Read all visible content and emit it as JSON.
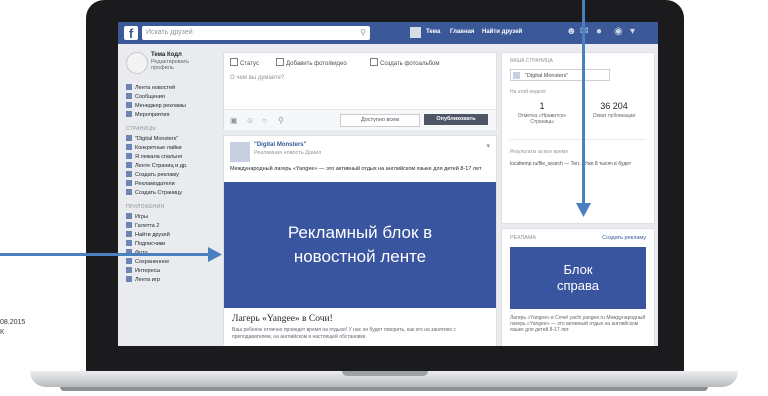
{
  "colors": {
    "fb_blue": "#3b5998",
    "ad_blue": "#3a559f",
    "arrow": "#4a7fc0"
  },
  "topbar": {
    "logo": "f",
    "search_placeholder": "Искать друзей",
    "nav": [
      "Тема",
      "Главная",
      "Найти друзей"
    ]
  },
  "left_nav": {
    "profile_name": "Тема Кодл",
    "profile_edit": "Редактировать профиль",
    "main_items": [
      "Лента новостей",
      "Сообщения",
      "Менеджер рекламы",
      "Мероприятия"
    ],
    "pages_section": "СТРАНИЦЫ",
    "pages_items": [
      "\"Digital Monsters\"",
      "Конкретные лайки",
      "Я лежала спальня",
      "Ленте Страниц и др.",
      "Создать рекламу",
      "Рекламодатели",
      "Создать Страницу"
    ],
    "apps_section": "ПРИЛОЖЕНИЯ",
    "apps_items": [
      "Игры",
      "Галетта 2",
      "Найти друзей",
      "Подписчики",
      "Фото",
      "Сохраненное",
      "Интересы",
      "Лента игр"
    ]
  },
  "composer": {
    "tabs": [
      "Статус",
      "Добавить фото/видео",
      "Создать фотоальбом"
    ],
    "placeholder": "О чем вы думаете?",
    "audience": "Доступно всем",
    "publish": "Опубликовать"
  },
  "post": {
    "page_name": "\"Digital Monsters\"",
    "sponsored": "Рекламная новость Данил",
    "text": "Международный лагерь «Yangee» — это активный отдых на английском языке для детей 8-17 лет",
    "ad_banner": "Рекламный блок в новостной ленте",
    "ad_title": "Лагерь «Yangee» в Сочи!",
    "ad_desc": "Ваш ребенок отлично проведет время на отдыхе! У нас он будет говорить, как его на занятиях с преподавателем, на английском в настоящей обстановке"
  },
  "right": {
    "page_label": "ВАША СТРАНИЦА",
    "page_name": "\"Digital Monsters\"",
    "this_week": "На этой неделе",
    "stat1_num": "1",
    "stat1_label": "Отметка «Нравится» Страницы",
    "stat2_num": "36 204",
    "stat2_label": "Охват публикации",
    "recent": "Результаты за все время",
    "recent_post": "localtemp.ru/file_search — Теп... Уже 8 тысяч в будет",
    "ads_label": "РЕКЛАМА",
    "create_ad": "Создать рекламу",
    "ad_banner": "Блок справа",
    "ad_text": "Лагерь «Yangee» в Сочи! yachi.yangee.ru Международный лагерь «Yangee» — это активный отдых на английском языке для детей 8-17 лет."
  },
  "outside": {
    "date_fragment": "08.2015",
    "k_fragment": "К"
  }
}
